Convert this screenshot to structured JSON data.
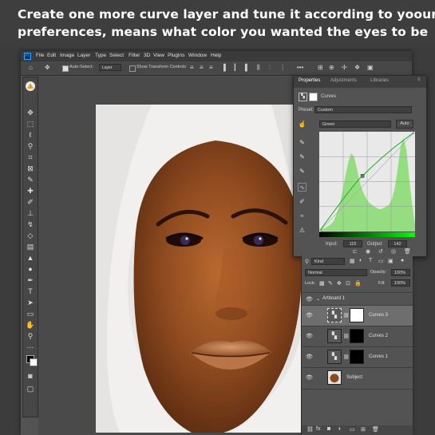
{
  "caption": {
    "line1": "Create one more curve layer and tune it according to yoour",
    "line2": "preferences, means what color you wanted the eyes to be"
  },
  "menu": {
    "logo": "Ps",
    "items": [
      "File",
      "Edit",
      "Image",
      "Layer",
      "Type",
      "Select",
      "Filter",
      "3D",
      "View",
      "Plugins",
      "Window",
      "Help"
    ]
  },
  "options": {
    "auto_select": "Auto-Select:",
    "auto_select_value": "Layer",
    "show_transform": "Show Transform Controls"
  },
  "properties": {
    "tabs": [
      "Properties",
      "Adjustments",
      "Libraries"
    ],
    "layer_type": "Curves",
    "preset_label": "Preset:",
    "preset_value": "Custom",
    "channel_value": "Green",
    "auto_label": "Auto",
    "input_label": "Input:",
    "input_value": "115",
    "output_label": "Output:",
    "output_value": "142"
  },
  "curve_points": [
    [
      0,
      0
    ],
    [
      115,
      142
    ],
    [
      255,
      255
    ]
  ],
  "layers": {
    "filter_label": "Kind",
    "blend_mode": "Normal",
    "opacity_label": "Opacity:",
    "opacity_value": "100%",
    "lock_label": "Lock:",
    "fill_label": "Fill:",
    "fill_value": "100%",
    "artboard": "Artboard 1",
    "rows": [
      {
        "name": "Curves 3"
      },
      {
        "name": "Curves 2"
      },
      {
        "name": "Curves 1"
      },
      {
        "name": "Subject"
      }
    ]
  },
  "colors": {
    "accent": "#31a8ff",
    "panel": "#535353",
    "histogram": "#8fdc7a",
    "curve_line": "#1faa2a"
  }
}
